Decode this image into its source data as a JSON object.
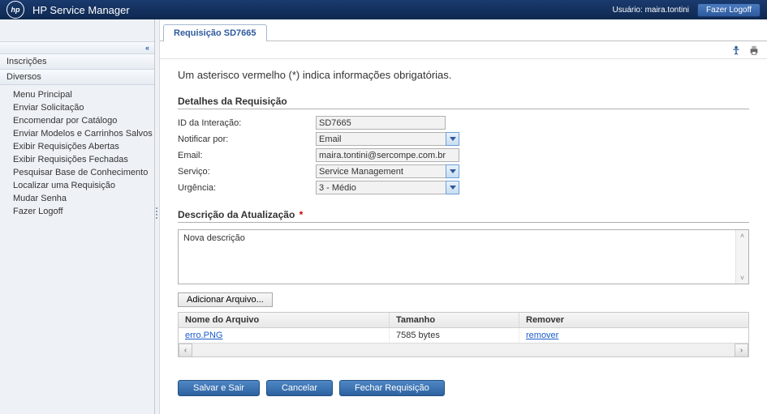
{
  "header": {
    "app_title": "HP Service Manager",
    "user_prefix": "Usuário:",
    "username": "maira.tontini",
    "logoff_button": "Fazer Logoff"
  },
  "sidebar": {
    "sections": {
      "inscricoes": "Inscrições",
      "diversos": "Diversos"
    },
    "menu_items": [
      "Menu Principal",
      "Enviar Solicitação",
      "Encomendar por Catálogo",
      "Enviar Modelos e Carrinhos Salvos",
      "Exibir Requisições Abertas",
      "Exibir Requisições Fechadas",
      "Pesquisar Base de Conhecimento",
      "Localizar uma Requisição",
      "Mudar Senha",
      "Fazer Logoff"
    ]
  },
  "tab": {
    "label": "Requisição SD7665"
  },
  "main": {
    "info_text": "Um asterisco vermelho (*) indica informações obrigatórias.",
    "details_title": "Detalhes da Requisição",
    "fields": {
      "id_label": "ID da Interação:",
      "id_value": "SD7665",
      "notify_label": "Notificar por:",
      "notify_value": "Email",
      "email_label": "Email:",
      "email_value": "maira.tontini@sercompe.com.br",
      "service_label": "Serviço:",
      "service_value": "Service Management",
      "urgency_label": "Urgência:",
      "urgency_value": "3 - Médio"
    },
    "desc_title": "Descrição da Atualização",
    "desc_value": "Nova descrição",
    "add_file_button": "Adicionar Arquivo...",
    "file_table": {
      "col_name": "Nome do Arquivo",
      "col_size": "Tamanho",
      "col_remove": "Remover",
      "rows": [
        {
          "name": "erro.PNG",
          "size": "7585 bytes",
          "remove": "remover"
        }
      ]
    },
    "actions": {
      "save": "Salvar e Sair",
      "cancel": "Cancelar",
      "close_req": "Fechar Requisição"
    }
  }
}
